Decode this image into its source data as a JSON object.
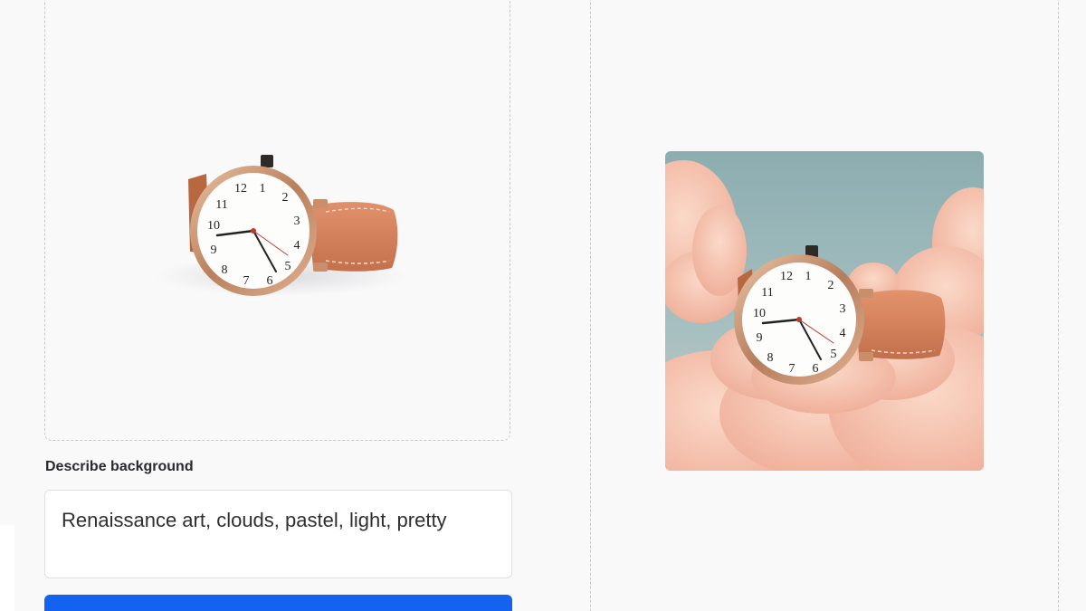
{
  "form": {
    "background_label": "Describe background",
    "background_prompt": "Renaissance art, clouds, pastel, light, pretty",
    "generate_button_label": ""
  },
  "images": {
    "input": "watch-product-photo",
    "result": "watch-on-pastel-clouds"
  },
  "colors": {
    "accent": "#1463f0",
    "strap": "#d9855f",
    "case": "#c98f6b",
    "sky": "#8fb0b3",
    "cloud": "#f3c2b0"
  }
}
